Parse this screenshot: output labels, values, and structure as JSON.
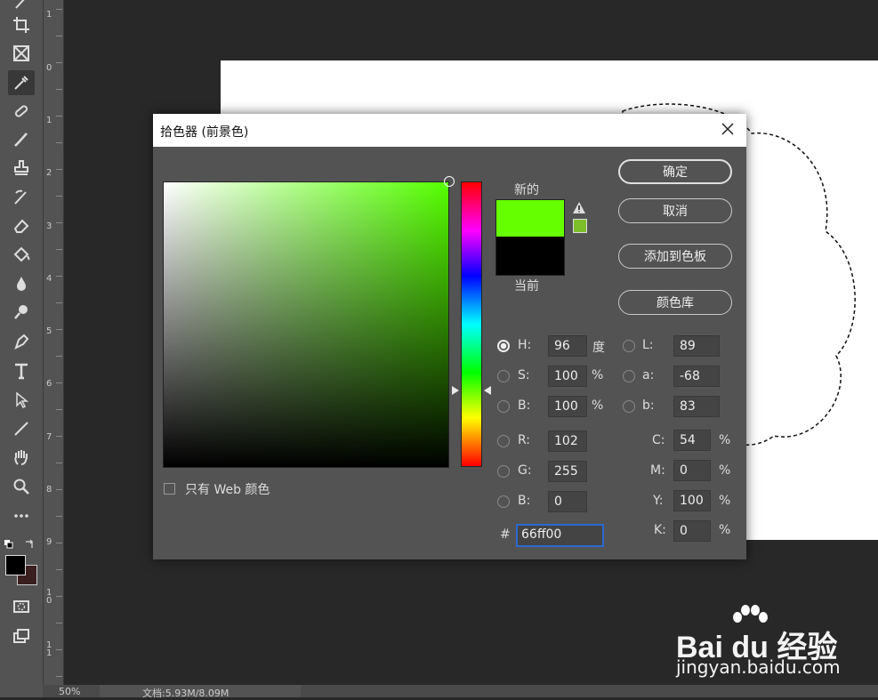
{
  "dialog": {
    "title": "拾色器 (前景色)",
    "buttons": {
      "ok": "确定",
      "cancel": "取消",
      "add_swatch": "添加到色板",
      "color_library": "颜色库"
    },
    "labels": {
      "new": "新的",
      "current": "当前"
    },
    "colors": {
      "new": "#66ff00",
      "current": "#000000",
      "web_safe": "#7cbf2a"
    },
    "web_only": "只有 Web 颜色",
    "fields": {
      "H": {
        "label": "H:",
        "value": "96",
        "unit": "度"
      },
      "S": {
        "label": "S:",
        "value": "100",
        "unit": "%"
      },
      "Bv": {
        "label": "B:",
        "value": "100",
        "unit": "%"
      },
      "R": {
        "label": "R:",
        "value": "102"
      },
      "G": {
        "label": "G:",
        "value": "255"
      },
      "Bb": {
        "label": "B:",
        "value": "0"
      },
      "L": {
        "label": "L:",
        "value": "89"
      },
      "a": {
        "label": "a:",
        "value": "-68"
      },
      "b": {
        "label": "b:",
        "value": "83"
      },
      "C": {
        "label": "C:",
        "value": "54",
        "unit": "%"
      },
      "M": {
        "label": "M:",
        "value": "0",
        "unit": "%"
      },
      "Y": {
        "label": "Y:",
        "value": "100",
        "unit": "%"
      },
      "K": {
        "label": "K:",
        "value": "0",
        "unit": "%"
      },
      "hex": {
        "label": "#",
        "value": "66ff00"
      }
    }
  },
  "ruler": {
    "labels": [
      "1",
      "0",
      "1",
      "2",
      "3",
      "4",
      "5",
      "6",
      "7",
      "8",
      "9",
      "1\n0",
      "1\n1"
    ]
  },
  "statusbar": {
    "zoom": "50%",
    "doc": "文档:5.93M/8.09M"
  },
  "watermark": {
    "line1": "Bai du 经验",
    "line2": "jingyan.baidu.com"
  },
  "tools": [
    "brush-icon",
    "crop-icon",
    "frame-icon",
    "eyedropper-icon",
    "healing-icon",
    "paint-brush-icon",
    "stamp-icon",
    "history-brush-icon",
    "eraser-icon",
    "bucket-icon",
    "blur-icon",
    "dodge-icon",
    "pen-icon",
    "type-icon",
    "path-select-icon",
    "line-icon",
    "hand-icon",
    "zoom-icon",
    "more-icon"
  ]
}
